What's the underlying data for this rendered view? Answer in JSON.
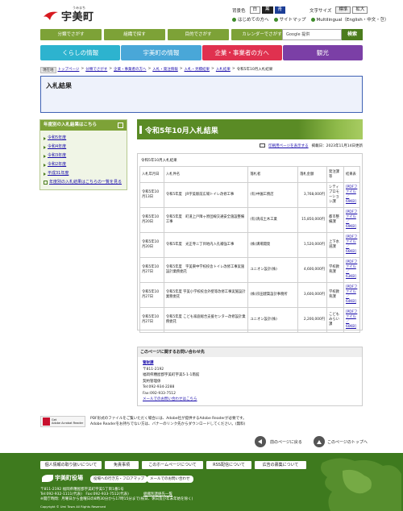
{
  "header": {
    "logo_text": "宇美町",
    "logo_kana": "うみまち",
    "bg_color_label": "背景色",
    "bg_options": [
      "白",
      "黒",
      "青"
    ],
    "text_size_label": "文字サイズ",
    "text_size_options": [
      "標準",
      "拡大"
    ],
    "links": [
      "はじめての方へ",
      "サイトマップ",
      "Multilingual（English・中文・한）"
    ]
  },
  "topnav": {
    "tabs": [
      "分類でさがす",
      "組織で探す",
      "目的でさがす",
      "カレンダーでさがす"
    ],
    "search_placeholder": "Google 提供",
    "search_button": "検索"
  },
  "categories": [
    "くらしの情報",
    "宇美町の情報",
    "企業・事業者の方へ",
    "観光"
  ],
  "breadcrumb": {
    "here_label": "現在地",
    "items": [
      "トップページ",
      "分類でさがす",
      "企業・事業者の方へ",
      "入札・発注情報",
      "入札・見積結果",
      "入札結果",
      "令和5年10月入札結果"
    ]
  },
  "page_head": {
    "title": "入札結果"
  },
  "sidebar": {
    "heading": "年度別の入札結果はこちら",
    "items": [
      "令和5年度",
      "令和4年度",
      "令和3年度",
      "令和2年度",
      "平成31年度"
    ],
    "more_link": "年度別の入札結果はこちらの一覧を見る"
  },
  "main": {
    "title": "令和5年10月入札結果",
    "print_link": "印刷用ページを表示する",
    "posted": "掲載日：2023年11月14日更新",
    "caption": "令和5年10月入札結果",
    "columns": [
      "入札年月日",
      "入札件名",
      "落札者",
      "落札金額",
      "発注課等",
      "結果表"
    ],
    "rows": [
      {
        "date": "令和5年10月13日",
        "title": "令和5年度　JR宇美駅前広場トイレ改修工事",
        "winner": "(有)中園工務店",
        "amount": "3,768,000円",
        "dept": "シティプロモーション課",
        "result": "[PDFファイル／69KB]"
      },
      {
        "date": "令和5年10月20日",
        "title": "令和5年度　町道上戸障ヶ原団線交通安全施設整備工事",
        "winner": "(有)清成土木工業",
        "amount": "15,850,000円",
        "dept": "都市整備課",
        "result": "[PDFファイル／69KB]"
      },
      {
        "date": "令和5年10月20日",
        "title": "令和5年度　光正寺ニ丁目地内入孔補強工事",
        "winner": "(株)溝場開発",
        "amount": "1,520,000円",
        "dept": "上下水道課",
        "result": "[PDFファイル／66KB]"
      },
      {
        "date": "令和5年10月27日",
        "title": "令和5年度　宇美東中学校校舎トイレ改修工事実施設計業務委託",
        "winner": "ユニオン設計(株)",
        "amount": "4,600,000円",
        "dept": "学校教育課",
        "result": "[PDFファイル／63KB]"
      },
      {
        "date": "令和5年10月27日",
        "title": "令和5年度 宇美小学校校舎外壁等改修工事実施設計業務委託",
        "winner": "(株)宗田建築設計事務所",
        "amount": "3,600,000円",
        "dept": "学校教育課",
        "result": "[PDFファイル／64KB]"
      },
      {
        "date": "令和5年10月27日",
        "title": "令和5年度 こども家庭総合支援センター改修設計業務委託",
        "winner": "ユニオン設計(株)",
        "amount": "2,200,000円",
        "dept": "こどもみらい課",
        "result": "[PDFファイル／60KB]"
      }
    ]
  },
  "inquiry": {
    "heading": "このページに関するお問い合わせ先",
    "dept": "管財課",
    "zip": "〒811-2192",
    "address": "福岡県糟屋郡宇美町宇美5-1-1南館",
    "section": "契約管理係",
    "tel": "Tel:092-934-2288",
    "fax": "Fax:092-933-7512",
    "mail_link": "メールでのお問い合わせはこちら"
  },
  "acrobat": {
    "badge_top": "Get",
    "badge_bottom": "Adobe Acrobat Reader",
    "line1": "PDF形式のファイルをご覧いただく場合には、Adobe社が提供するAdobe Readerが必要です。",
    "line2": "Adobe Readerをお持ちでない方は、バナーのリンク先からダウンロードしてください。(無料)"
  },
  "pagenav": {
    "back": "前のページに戻る",
    "top": "このページのトップへ"
  },
  "footer": {
    "buttons": [
      "個人情報の取り扱いについて",
      "免責事項",
      "このホームページについて",
      "RSS配信について",
      "広告の募集について"
    ],
    "logo": "宇美町役場",
    "pill1": "役場への行き方・フロアマップ",
    "pill2": "メールでのお問い合わせ",
    "address": "〒811-2192 福岡県糟屋郡宇美町宇美5丁目1番1号",
    "tel": "Tel:092-932-1111(代表)　Fax:092-933-7512(代表)",
    "org_link": "組織別連絡先一覧",
    "hours": "※開庁時間：月曜日から金曜日の8時30分から17時15分まで(祝日、休日及び年末年始を除く)",
    "copyright": "Copyright © Umi Town All Rights Reserved"
  },
  "colors": {
    "nav_green": "#7da237",
    "dark_green": "#4b7c1e",
    "footer_green": "#3e7a1e",
    "cat_cyan": "#2db3cf",
    "cat_blue": "#49a7d8",
    "cat_red": "#e0314f",
    "cat_purple": "#7b3fa6",
    "head_border": "#3f62b4"
  }
}
